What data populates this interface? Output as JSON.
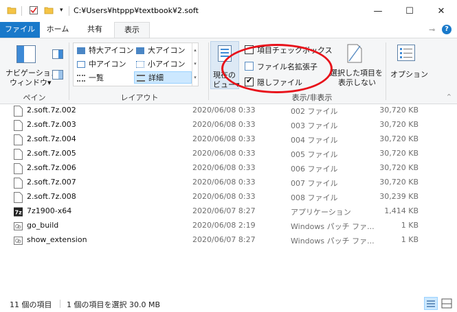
{
  "window": {
    "path": "C:¥Users¥htppp¥textbook¥2.soft",
    "minimize_glyph": "—",
    "maximize_glyph": "☐",
    "close_glyph": "✕"
  },
  "tabs": [
    {
      "label": "ファイル"
    },
    {
      "label": "ホーム"
    },
    {
      "label": "共有"
    },
    {
      "label": "表示"
    }
  ],
  "ribbon": {
    "pane_group": {
      "nav_pane_label_1": "ナビゲーション",
      "nav_pane_label_2": "ウィンドウ▾",
      "group_label": "ペイン"
    },
    "layout_group": {
      "items": [
        {
          "label": "特大アイコン"
        },
        {
          "label": "大アイコン"
        },
        {
          "label": "中アイコン"
        },
        {
          "label": "小アイコン"
        },
        {
          "label": "一覧"
        },
        {
          "label": "詳細"
        }
      ],
      "group_label": "レイアウト"
    },
    "current_view": {
      "label_1": "現在の",
      "label_2": "ビュー▾"
    },
    "show_hide": {
      "item_checkboxes": "項目チェックボックス",
      "file_extensions": "ファイル名拡張子",
      "hidden_items": "隠しファイル",
      "hide_selected_1": "選択した項目を",
      "hide_selected_2": "表示しない",
      "group_label": "表示/非表示"
    },
    "options": {
      "label": "オプション"
    }
  },
  "files": [
    {
      "name": "2.soft.7z.002",
      "date": "2020/06/08 0:33",
      "type": "002 ファイル",
      "size": "30,720 KB",
      "icon": "file-icon"
    },
    {
      "name": "2.soft.7z.003",
      "date": "2020/06/08 0:33",
      "type": "003 ファイル",
      "size": "30,720 KB",
      "icon": "file-icon"
    },
    {
      "name": "2.soft.7z.004",
      "date": "2020/06/08 0:33",
      "type": "004 ファイル",
      "size": "30,720 KB",
      "icon": "file-icon"
    },
    {
      "name": "2.soft.7z.005",
      "date": "2020/06/08 0:33",
      "type": "005 ファイル",
      "size": "30,720 KB",
      "icon": "file-icon"
    },
    {
      "name": "2.soft.7z.006",
      "date": "2020/06/08 0:33",
      "type": "006 ファイル",
      "size": "30,720 KB",
      "icon": "file-icon"
    },
    {
      "name": "2.soft.7z.007",
      "date": "2020/06/08 0:33",
      "type": "007 ファイル",
      "size": "30,720 KB",
      "icon": "file-icon"
    },
    {
      "name": "2.soft.7z.008",
      "date": "2020/06/08 0:33",
      "type": "008 ファイル",
      "size": "30,239 KB",
      "icon": "file-icon"
    },
    {
      "name": "7z1900-x64",
      "date": "2020/06/07 8:27",
      "type": "アプリケーション",
      "size": "1,414 KB",
      "icon": "7zip-icon"
    },
    {
      "name": "go_build",
      "date": "2020/06/08 2:19",
      "type": "Windows パッチ ファ...",
      "size": "1 KB",
      "icon": "patch-icon"
    },
    {
      "name": "show_extension",
      "date": "2020/06/07 8:27",
      "type": "Windows パッチ ファ...",
      "size": "1 KB",
      "icon": "patch-icon"
    }
  ],
  "status": {
    "item_count": "11 個の項目",
    "selection": "1 個の項目を選択 30.0 MB"
  },
  "colors": {
    "file_tab": "#1979ca",
    "annotation_circle": "#e8111a",
    "selection": "#cce8ff"
  }
}
